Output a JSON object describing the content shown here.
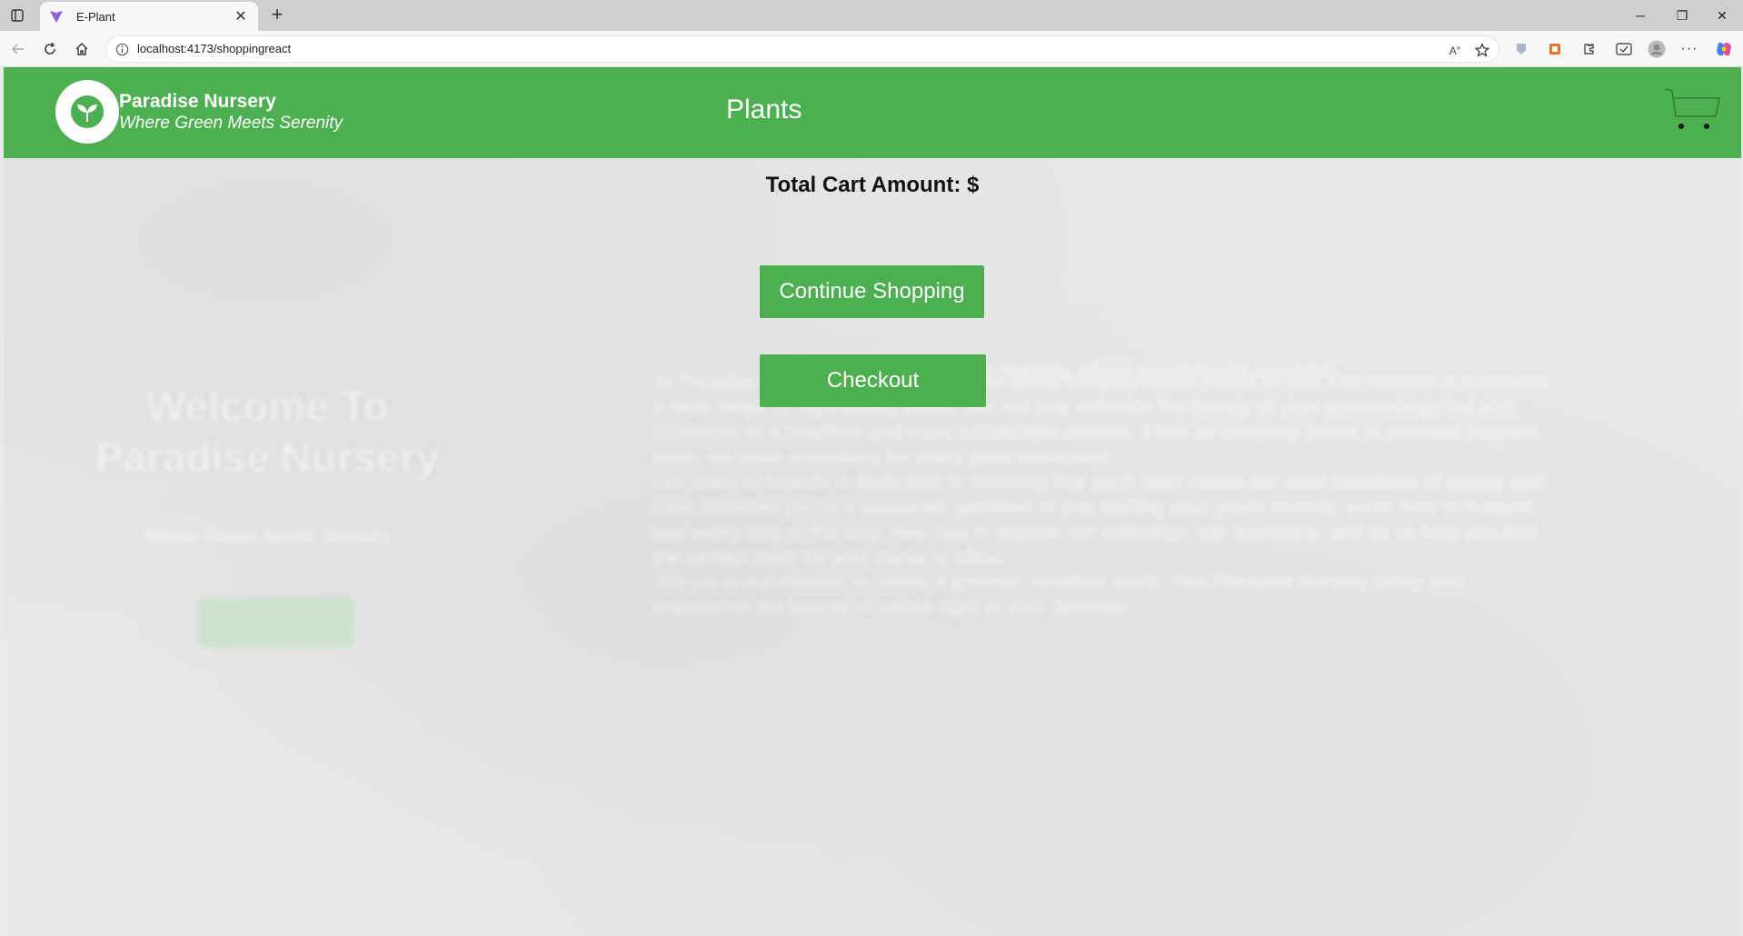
{
  "browser": {
    "tab_title": "E-Plant",
    "url": "localhost:4173/shoppingreact",
    "icons": [
      "tab-actions-icon",
      "vite-favicon",
      "close-tab-icon",
      "new-tab-icon",
      "minimize-icon",
      "restore-icon",
      "close-window-icon",
      "back-icon",
      "reload-icon",
      "home-icon",
      "site-info-icon",
      "read-aloud-icon",
      "favorite-star-icon",
      "extension-icons",
      "profile-icon",
      "more-icon",
      "copilot-icon"
    ]
  },
  "header": {
    "brand_name": "Paradise Nursery",
    "brand_tagline": "Where Green Meets Serenity",
    "title": "Plants",
    "logo_icon": "sprout-icon",
    "cart_icon": "cart-icon"
  },
  "cart": {
    "total_label": "Total Cart Amount: $",
    "continue_label": "Continue Shopping",
    "checkout_label": "Checkout"
  },
  "background": {
    "welcome": "Welcome To Paradise Nursery",
    "tagline": "Where Green Meets Serenity",
    "heading": "Welcome to Paradise Nursery, where green meets serenity!",
    "paragraphs": [
      "At Paradise Nursery, we are passionate about bringing nature closer to you. Our mission is to provide a wide range of high-quality plants that not only enhance the beauty of your surroundings but also contribute to a healthier and more sustainable lifestyle. From air-purifying plants to aromatic fragrant ones, we have something for every plant enthusiast.",
      "Our team of experts is dedicated to ensuring that each plant meets our strict standards of quality and care. Whether you're a seasoned gardener or just starting your green journey, we're here to support you every step of the way. Feel free to explore our collection, ask questions, and let us help you find the perfect plant for your home or office.",
      "Join us in our mission to create a greener, healthier world. Visit Paradise Nursery today and experience the beauty of nature right at your doorstep."
    ]
  },
  "colors": {
    "brand_green": "#4caf50",
    "page_bg": "#e8e8e8"
  }
}
